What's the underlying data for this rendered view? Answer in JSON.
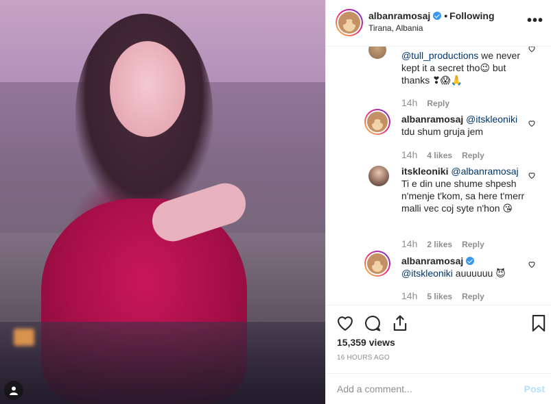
{
  "post": {
    "username": "albanramosaj",
    "separator": "•",
    "follow_state": "Following",
    "location": "Tirana, Albania",
    "more_label": "•••"
  },
  "comments": [
    {
      "username": "",
      "mention": "@tull_productions",
      "text": " we never kept it a secret tho😉 but thanks ❣😱🙏",
      "time": "14h",
      "likes": "",
      "reply_label": "Reply"
    },
    {
      "username": "albanramosaj",
      "mention": "@itskleoniki",
      "text": "tdu shum gruja jem",
      "time": "14h",
      "likes": "4 likes",
      "reply_label": "Reply"
    },
    {
      "username": "itskleoniki",
      "mention": "@albanramosaj",
      "text": "Ti e din une shume shpesh n'menje t'kom, sa here t'merr malli vec coj syte n'hon 😘",
      "time": "14h",
      "likes": "2 likes",
      "reply_label": "Reply"
    },
    {
      "username": "albanramosaj",
      "mention": "@itskleoniki",
      "text": " auuuuuu 😈",
      "time": "14h",
      "likes": "5 likes",
      "reply_label": "Reply"
    }
  ],
  "stats": {
    "views": "15,359 views",
    "posted": "16 HOURS AGO"
  },
  "comment_box": {
    "placeholder": "Add a comment...",
    "post_label": "Post"
  },
  "colors": {
    "verified": "#3897f0",
    "mention": "#003569",
    "muted": "#8e8e8e",
    "post_disabled": "#b2dffc"
  },
  "icons": [
    "verified-badge-icon",
    "more-options-icon",
    "heart-icon",
    "comment-icon",
    "share-icon",
    "bookmark-icon",
    "user-tag-icon"
  ]
}
